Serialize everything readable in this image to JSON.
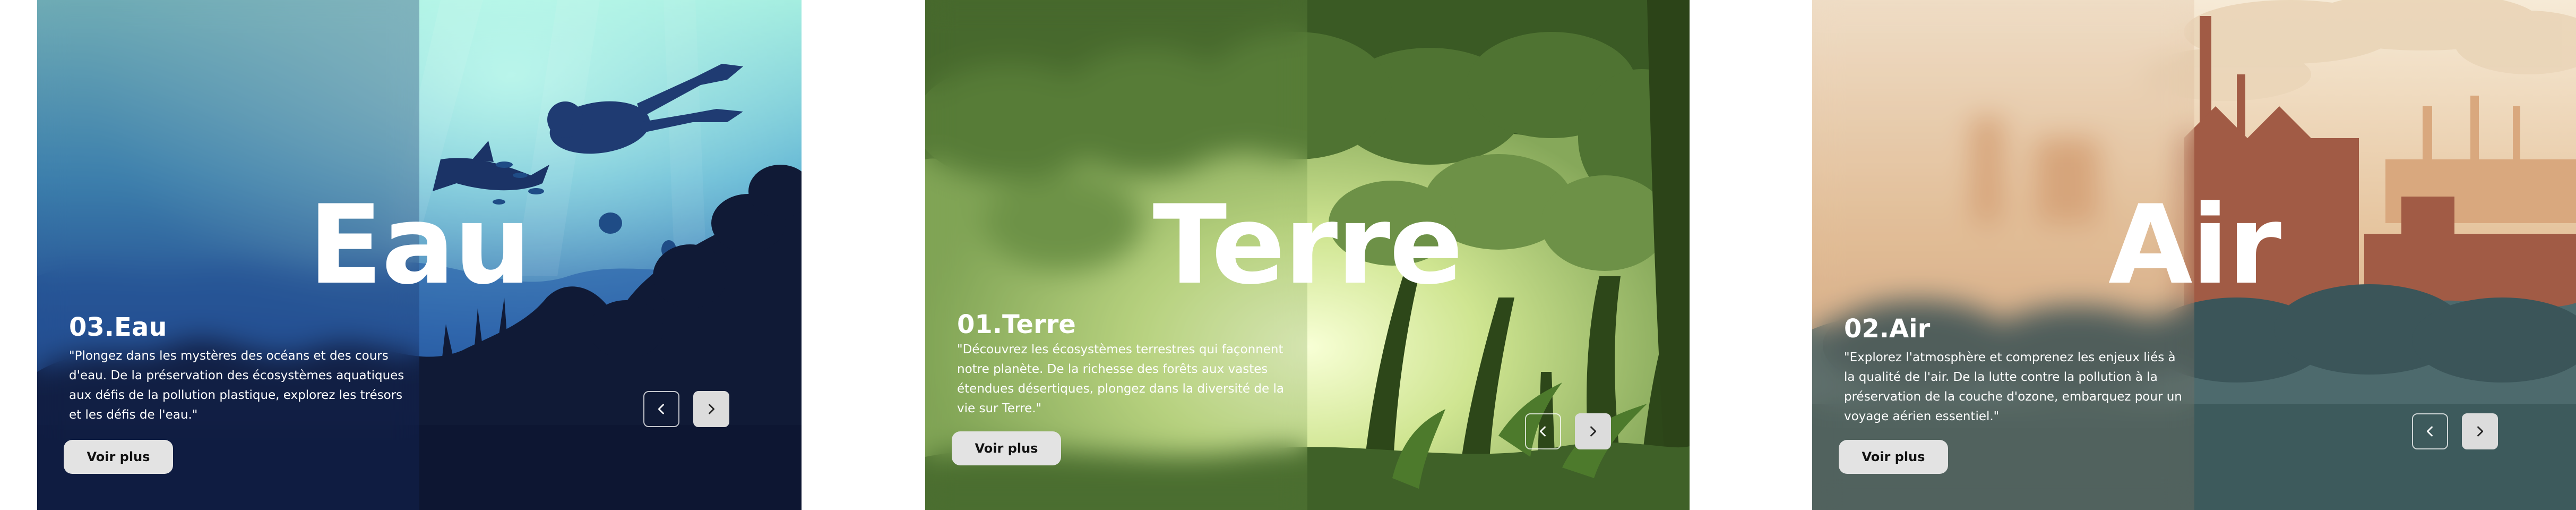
{
  "cards": [
    {
      "big_word": "Eau",
      "title": "03.Eau",
      "description": "\"Plongez dans les mystères des océans et des cours d'eau. De la préservation des écosystèmes aquatiques aux défis de la pollution plastique, explorez les trésors et les défis de l'eau.\"",
      "button_label": "Voir plus",
      "prev_icon": "chevron-left",
      "next_icon": "chevron-right"
    },
    {
      "big_word": "Terre",
      "title": "01.Terre",
      "description": "\"Découvrez les écosystèmes terrestres qui façonnent notre planète. De la richesse des forêts aux vastes étendues désertiques, plongez dans la diversité de la vie sur Terre.\"",
      "button_label": "Voir plus",
      "prev_icon": "chevron-left",
      "next_icon": "chevron-right"
    },
    {
      "big_word": "Air",
      "title": "02.Air",
      "description": "\"Explorez l'atmosphère et comprenez les enjeux liés à la qualité de l'air. De la lutte contre la pollution à la préservation de la couche d'ozone, embarquez pour un voyage aérien essentiel.\"",
      "button_label": "Voir plus",
      "prev_icon": "chevron-left",
      "next_icon": "chevron-right"
    }
  ],
  "colors": {
    "water_deep": "#0f1d3a",
    "water_light": "#8fe0d6",
    "forest_dark": "#2f4a1e",
    "forest_light": "#f3ffc8",
    "air_sky": "#f2e2c9",
    "air_smog": "#3c5a60",
    "button_bg": "#e3e3e3"
  }
}
